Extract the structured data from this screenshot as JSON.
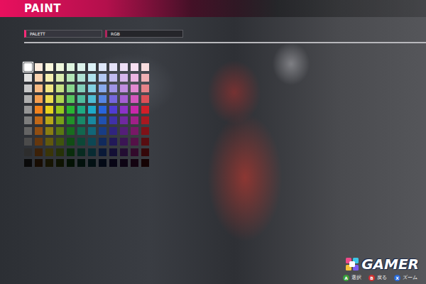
{
  "header": {
    "title": "PAINT"
  },
  "tabs": [
    {
      "label": "PALETT",
      "selected": true
    },
    {
      "label": "RGB",
      "selected": false
    }
  ],
  "palette": {
    "rows": [
      [
        {
          "color": "#ffffff",
          "selected": true
        },
        {
          "color": "#fdecdd",
          "selected": false
        },
        {
          "color": "#fbf8dd",
          "selected": false
        },
        {
          "color": "#eff7dd",
          "selected": false
        },
        {
          "color": "#dff4e0",
          "selected": false
        },
        {
          "color": "#ddf2ec",
          "selected": false
        },
        {
          "color": "#ddf2f7",
          "selected": false
        },
        {
          "color": "#dfe8fa",
          "selected": false
        },
        {
          "color": "#e5e2f8",
          "selected": false
        },
        {
          "color": "#eee0f7",
          "selected": false
        },
        {
          "color": "#f7dff2",
          "selected": false
        },
        {
          "color": "#f8dddf",
          "selected": false
        }
      ],
      [
        {
          "color": "#e1e1e1",
          "selected": false
        },
        {
          "color": "#fad3b0",
          "selected": false
        },
        {
          "color": "#f6efb0",
          "selected": false
        },
        {
          "color": "#daecb0",
          "selected": false
        },
        {
          "color": "#b4e5b7",
          "selected": false
        },
        {
          "color": "#b0e1d3",
          "selected": false
        },
        {
          "color": "#b0e1ec",
          "selected": false
        },
        {
          "color": "#b4c9f3",
          "selected": false
        },
        {
          "color": "#c2bbef",
          "selected": false
        },
        {
          "color": "#d7b7ec",
          "selected": false
        },
        {
          "color": "#ecb4e1",
          "selected": false
        },
        {
          "color": "#efb0b4",
          "selected": false
        }
      ],
      [
        {
          "color": "#c8c8c8",
          "selected": false
        },
        {
          "color": "#f7ba83",
          "selected": false
        },
        {
          "color": "#f1e683",
          "selected": false
        },
        {
          "color": "#c5e183",
          "selected": false
        },
        {
          "color": "#89d68e",
          "selected": false
        },
        {
          "color": "#83d0ba",
          "selected": false
        },
        {
          "color": "#83d0e1",
          "selected": false
        },
        {
          "color": "#89aaec",
          "selected": false
        },
        {
          "color": "#9f94e6",
          "selected": false
        },
        {
          "color": "#c08ee1",
          "selected": false
        },
        {
          "color": "#e189d0",
          "selected": false
        },
        {
          "color": "#e68389",
          "selected": false
        }
      ],
      [
        {
          "color": "#afafaf",
          "selected": false
        },
        {
          "color": "#f39e50",
          "selected": false
        },
        {
          "color": "#ecdc50",
          "selected": false
        },
        {
          "color": "#add450",
          "selected": false
        },
        {
          "color": "#57c55f",
          "selected": false
        },
        {
          "color": "#50bd9e",
          "selected": false
        },
        {
          "color": "#50bdd4",
          "selected": false
        },
        {
          "color": "#5786e4",
          "selected": false
        },
        {
          "color": "#7667dc",
          "selected": false
        },
        {
          "color": "#a55fd4",
          "selected": false
        },
        {
          "color": "#d457bd",
          "selected": false
        },
        {
          "color": "#dc5057",
          "selected": false
        }
      ],
      [
        {
          "color": "#969696",
          "selected": false
        },
        {
          "color": "#f0821e",
          "selected": false
        },
        {
          "color": "#e6d21e",
          "selected": false
        },
        {
          "color": "#96c81e",
          "selected": false
        },
        {
          "color": "#28b432",
          "selected": false
        },
        {
          "color": "#1eaa82",
          "selected": false
        },
        {
          "color": "#1eaac8",
          "selected": false
        },
        {
          "color": "#2864dc",
          "selected": false
        },
        {
          "color": "#503cd2",
          "selected": false
        },
        {
          "color": "#8c32c8",
          "selected": false
        },
        {
          "color": "#c828aa",
          "selected": false
        },
        {
          "color": "#d21e28",
          "selected": false
        }
      ],
      [
        {
          "color": "#7d7d7d",
          "selected": false
        },
        {
          "color": "#c06818",
          "selected": false
        },
        {
          "color": "#b8a818",
          "selected": false
        },
        {
          "color": "#78a018",
          "selected": false
        },
        {
          "color": "#209028",
          "selected": false
        },
        {
          "color": "#188868",
          "selected": false
        },
        {
          "color": "#1888a0",
          "selected": false
        },
        {
          "color": "#2050b0",
          "selected": false
        },
        {
          "color": "#4030a8",
          "selected": false
        },
        {
          "color": "#7028a0",
          "selected": false
        },
        {
          "color": "#a02088",
          "selected": false
        },
        {
          "color": "#a81820",
          "selected": false
        }
      ],
      [
        {
          "color": "#646464",
          "selected": false
        },
        {
          "color": "#904e12",
          "selected": false
        },
        {
          "color": "#8a7e12",
          "selected": false
        },
        {
          "color": "#5a7812",
          "selected": false
        },
        {
          "color": "#186c1e",
          "selected": false
        },
        {
          "color": "#12664e",
          "selected": false
        },
        {
          "color": "#126678",
          "selected": false
        },
        {
          "color": "#183c84",
          "selected": false
        },
        {
          "color": "#30247e",
          "selected": false
        },
        {
          "color": "#541e78",
          "selected": false
        },
        {
          "color": "#781866",
          "selected": false
        },
        {
          "color": "#7e1218",
          "selected": false
        }
      ],
      [
        {
          "color": "#4b4b4b",
          "selected": false
        },
        {
          "color": "#65370d",
          "selected": false
        },
        {
          "color": "#61580d",
          "selected": false
        },
        {
          "color": "#3f540d",
          "selected": false
        },
        {
          "color": "#114c15",
          "selected": false
        },
        {
          "color": "#0d4737",
          "selected": false
        },
        {
          "color": "#0d4754",
          "selected": false
        },
        {
          "color": "#112a5c",
          "selected": false
        },
        {
          "color": "#221958",
          "selected": false
        },
        {
          "color": "#3b1554",
          "selected": false
        },
        {
          "color": "#541147",
          "selected": false
        },
        {
          "color": "#580d11",
          "selected": false
        }
      ],
      [
        {
          "color": "#2d2d2d",
          "selected": false
        },
        {
          "color": "#3c2108",
          "selected": false
        },
        {
          "color": "#3a3508",
          "selected": false
        },
        {
          "color": "#263208",
          "selected": false
        },
        {
          "color": "#0a2d0d",
          "selected": false
        },
        {
          "color": "#082b21",
          "selected": false
        },
        {
          "color": "#082b32",
          "selected": false
        },
        {
          "color": "#0a1937",
          "selected": false
        },
        {
          "color": "#140f35",
          "selected": false
        },
        {
          "color": "#230d32",
          "selected": false
        },
        {
          "color": "#320a2b",
          "selected": false
        },
        {
          "color": "#35080a",
          "selected": false
        }
      ],
      [
        {
          "color": "#0a0a0a",
          "selected": false
        },
        {
          "color": "#180d03",
          "selected": false
        },
        {
          "color": "#171503",
          "selected": false
        },
        {
          "color": "#0f1403",
          "selected": false
        },
        {
          "color": "#041205",
          "selected": false
        },
        {
          "color": "#03110d",
          "selected": false
        },
        {
          "color": "#031114",
          "selected": false
        },
        {
          "color": "#040a16",
          "selected": false
        },
        {
          "color": "#080615",
          "selected": false
        },
        {
          "color": "#0e0514",
          "selected": false
        },
        {
          "color": "#140411",
          "selected": false
        },
        {
          "color": "#150304",
          "selected": false
        }
      ]
    ]
  },
  "hints": [
    {
      "key": "A",
      "label": "選択",
      "color": "#3aa03a"
    },
    {
      "key": "B",
      "label": "戻る",
      "color": "#d03030"
    },
    {
      "key": "X",
      "label": "ズーム",
      "color": "#2a6ad8"
    }
  ],
  "watermark": {
    "text": "GAMER"
  }
}
